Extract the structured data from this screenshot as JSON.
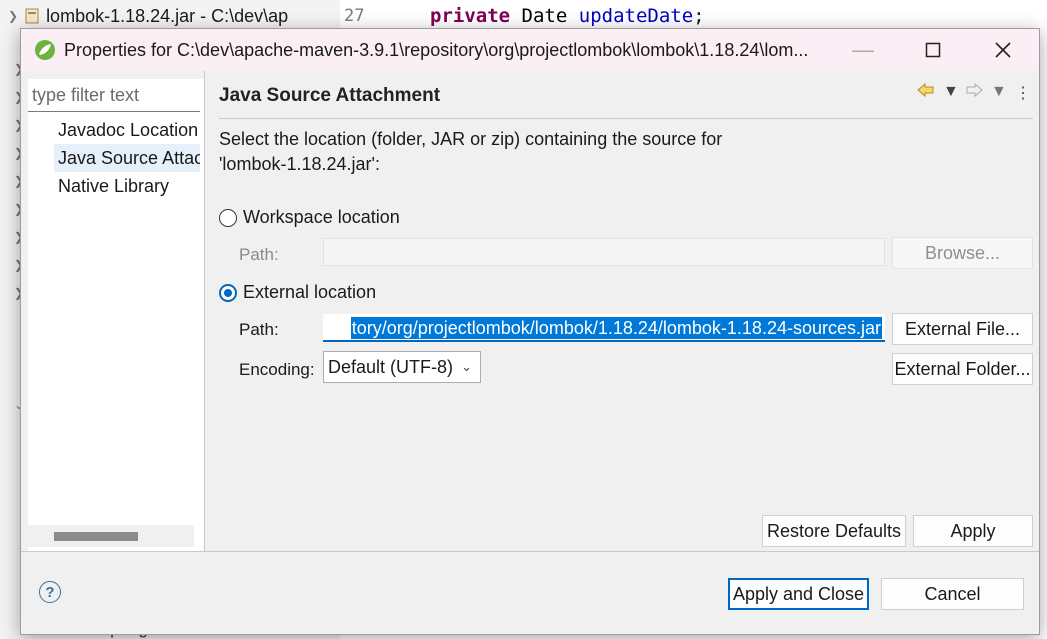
{
  "background": {
    "explorer_item": "lombok-1.18.24.jar - C:\\dev\\ap",
    "editor_line_number": "27",
    "editor_keyword": "private",
    "editor_type": "Date",
    "editor_field": "updateDate",
    "editor_semicolon": ";",
    "bottom_tree_item": "spring"
  },
  "dialog": {
    "title": "Properties for C:\\dev\\apache-maven-3.9.1\\repository\\org\\projectlombok\\lombok\\1.18.24\\lom...",
    "filter_placeholder": "type filter text",
    "nav_items": [
      {
        "label": "Javadoc Location"
      },
      {
        "label": "Java Source Attachment"
      },
      {
        "label": "Native Library"
      }
    ],
    "page_title": "Java Source Attachment",
    "description_line1": "Select the location (folder, JAR or zip) containing the source for",
    "description_line2": "'lombok-1.18.24.jar':",
    "workspace": {
      "label": "Workspace location",
      "path_label": "Path:",
      "path_value": "",
      "browse_label": "Browse..."
    },
    "external": {
      "label": "External location",
      "path_label": "Path:",
      "path_visible": "tory/org/projectlombok/lombok/1.18.24/lombok-1.18.24-sources.jar",
      "external_file_label": "External File...",
      "encoding_label": "Encoding:",
      "encoding_value": "Default (UTF-8)",
      "external_folder_label": "External Folder..."
    },
    "restore_defaults_label": "Restore Defaults",
    "apply_label": "Apply",
    "apply_close_label": "Apply and Close",
    "cancel_label": "Cancel",
    "help_symbol": "?",
    "colors": {
      "accent": "#0067c0",
      "selection": "#0078d7",
      "titlebar": "#fbeef4"
    }
  }
}
